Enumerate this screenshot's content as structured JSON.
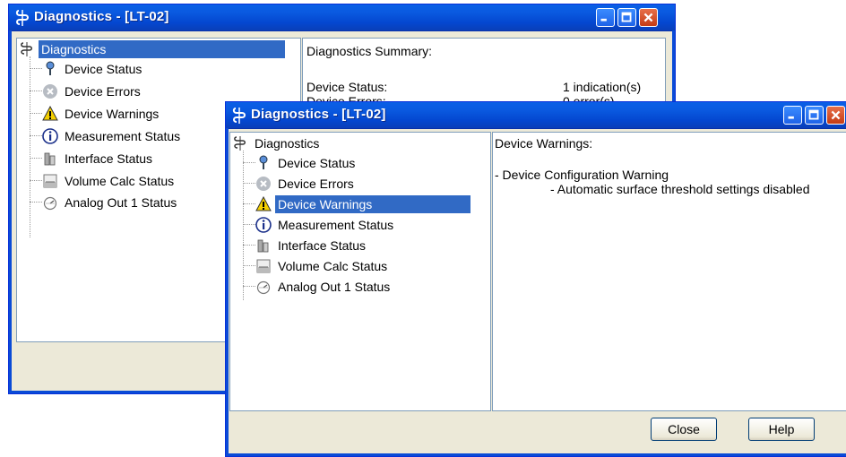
{
  "back_window": {
    "title": "Diagnostics - [LT-02]",
    "tree": {
      "root": "Diagnostics",
      "items": [
        "Device Status",
        "Device Errors",
        "Device Warnings",
        "Measurement Status",
        "Interface Status",
        "Volume Calc Status",
        "Analog Out 1 Status"
      ]
    },
    "summary": {
      "heading": "Diagnostics Summary:",
      "row_label": "Device Status:",
      "row_value": "1 indication(s)",
      "row2_label": "Device Errors:",
      "row2_value": "0 error(s)"
    }
  },
  "front_window": {
    "title": "Diagnostics - [LT-02]",
    "tree": {
      "root": "Diagnostics",
      "items": [
        "Device Status",
        "Device Errors",
        "Device Warnings",
        "Measurement Status",
        "Interface Status",
        "Volume Calc Status",
        "Analog Out 1 Status"
      ],
      "selected": "Device Warnings"
    },
    "detail": {
      "heading": "Device Warnings:",
      "line1": "- Device Configuration Warning",
      "line2": "- Automatic surface threshold settings disabled"
    },
    "buttons": {
      "close": "Close",
      "help": "Help"
    }
  },
  "icons": {
    "app": "probe-icon",
    "device_status": "probe-icon",
    "device_errors": "error-circle-icon",
    "device_warnings": "warning-triangle-icon",
    "measurement_status": "info-icon",
    "interface_status": "interface-icon",
    "volume_calc_status": "tank-icon",
    "analog_out": "gauge-icon"
  },
  "colors": {
    "title_bar": "#0a5ae0",
    "selection": "#316ac5",
    "window_face": "#ece9d8"
  }
}
